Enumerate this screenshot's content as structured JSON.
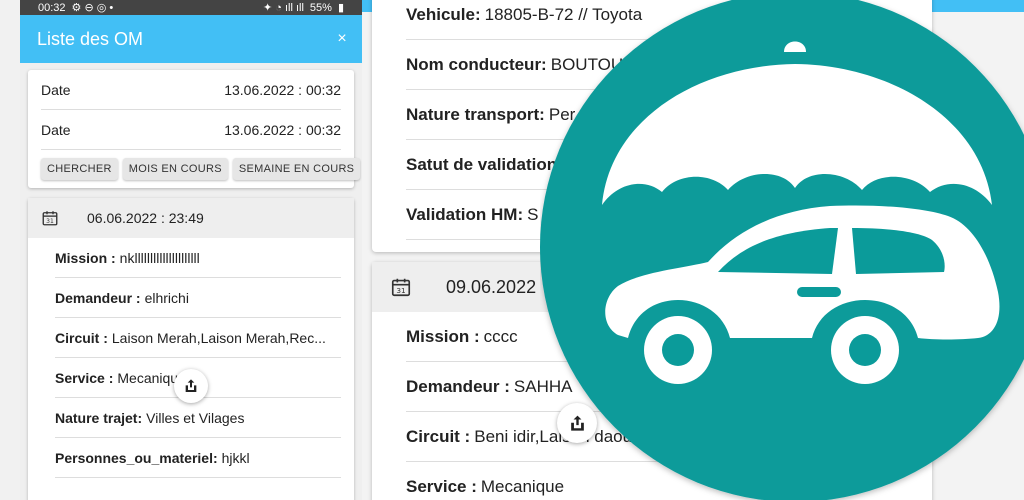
{
  "status_bar": {
    "time": "00:32",
    "battery": "55%"
  },
  "app_bar": {
    "title": "Liste des OM",
    "close": "×"
  },
  "filters": {
    "rows": [
      {
        "label": "Date",
        "value": "13.06.2022 : 00:32"
      },
      {
        "label": "Date",
        "value": "13.06.2022 : 00:32"
      }
    ],
    "buttons": [
      "CHERCHER",
      "MOIS EN COURS",
      "SEMAINE EN COURS"
    ]
  },
  "left_card": {
    "date": "06.06.2022 : 23:49",
    "fields": [
      {
        "label": "Mission :",
        "value": "nklllllllllllllllllllll"
      },
      {
        "label": "Demandeur :",
        "value": "elhrichi"
      },
      {
        "label": "Circuit :",
        "value": "Laison Merah,Laison Merah,Rec..."
      },
      {
        "label": "Service :",
        "value": "Mecaniqu"
      },
      {
        "label": "Nature trajet:",
        "value": "Villes et Vilages"
      },
      {
        "label": "Personnes_ou_materiel:",
        "value": "hjkkl"
      }
    ]
  },
  "right_top_card": {
    "fields": [
      {
        "label": "Vehicule:",
        "value": "18805-B-72 // Toyota"
      },
      {
        "label": "Nom conducteur:",
        "value": "BOUTOUR"
      },
      {
        "label": "Nature transport:",
        "value": "Per"
      },
      {
        "label": "Satut de validation",
        "value": ""
      },
      {
        "label": "Validation HM:",
        "value": "S"
      }
    ]
  },
  "right_bottom_card": {
    "date": "09.06.2022",
    "fields": [
      {
        "label": "Mission :",
        "value": "cccc"
      },
      {
        "label": "Demandeur :",
        "value": "SAHHA"
      },
      {
        "label": "Circuit :",
        "value": "Beni idir,Laison daoui,"
      },
      {
        "label": "Service :",
        "value": "Mecanique"
      }
    ]
  },
  "icons": {
    "calendar": "calendar-icon",
    "share": "share-icon",
    "logo": "car-umbrella-logo-icon"
  },
  "colors": {
    "app_bar": "#42bff5",
    "logo_teal": "#0b9b9a",
    "card_header": "#eeeeee"
  }
}
